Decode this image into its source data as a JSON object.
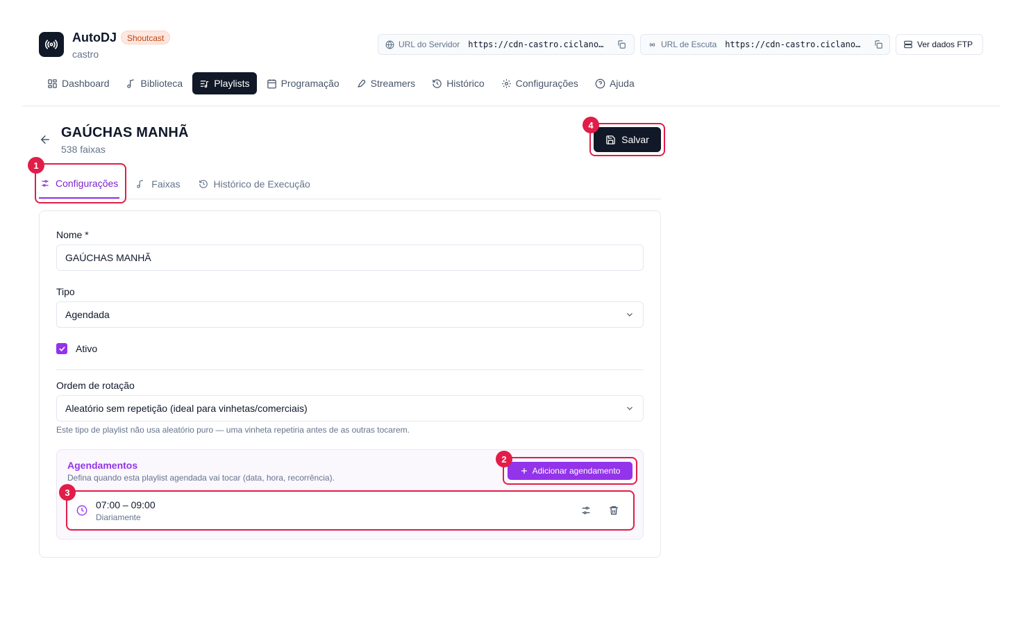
{
  "header": {
    "app_title": "AutoDJ",
    "badge": "Shoutcast",
    "subtitle": "castro",
    "server_url_label": "URL do Servidor",
    "server_url_value": "https://cdn-castro.ciclano…",
    "listen_url_label": "URL de Escuta",
    "listen_url_value": "https://cdn-castro.ciclano…",
    "ftp_button": "Ver dados FTP"
  },
  "nav": {
    "items": [
      {
        "label": "Dashboard",
        "icon": "dashboard-icon"
      },
      {
        "label": "Biblioteca",
        "icon": "music-note-icon"
      },
      {
        "label": "Playlists",
        "icon": "playlist-icon",
        "active": true
      },
      {
        "label": "Programação",
        "icon": "calendar-icon"
      },
      {
        "label": "Streamers",
        "icon": "microphone-icon"
      },
      {
        "label": "Histórico",
        "icon": "history-icon"
      },
      {
        "label": "Configurações",
        "icon": "gear-icon"
      },
      {
        "label": "Ajuda",
        "icon": "help-icon"
      }
    ]
  },
  "page": {
    "title": "GAÚCHAS MANHÃ",
    "subtitle": "538 faixas",
    "save_label": "Salvar"
  },
  "tabs": [
    {
      "label": "Configurações",
      "active": true
    },
    {
      "label": "Faixas"
    },
    {
      "label": "Histórico de Execução"
    }
  ],
  "form": {
    "name_label": "Nome *",
    "name_value": "GAÚCHAS MANHÃ",
    "type_label": "Tipo",
    "type_value": "Agendada",
    "active_label": "Ativo",
    "active_checked": true,
    "rotation_label": "Ordem de rotação",
    "rotation_value": "Aleatório sem repetição (ideal para vinhetas/comerciais)",
    "rotation_hint": "Este tipo de playlist não usa aleatório puro — uma vinheta repetiria antes de as outras tocarem."
  },
  "schedules": {
    "title": "Agendamentos",
    "subtitle": "Defina quando esta playlist agendada vai tocar (data, hora, recorrência).",
    "add_label": "Adicionar agendamento",
    "items": [
      {
        "time": "07:00 – 09:00",
        "frequency": "Diariamente"
      }
    ]
  },
  "annotations": [
    "1",
    "2",
    "3",
    "4"
  ],
  "colors": {
    "accent": "#9333ea",
    "dark": "#111827",
    "highlight": "#e11d48"
  }
}
